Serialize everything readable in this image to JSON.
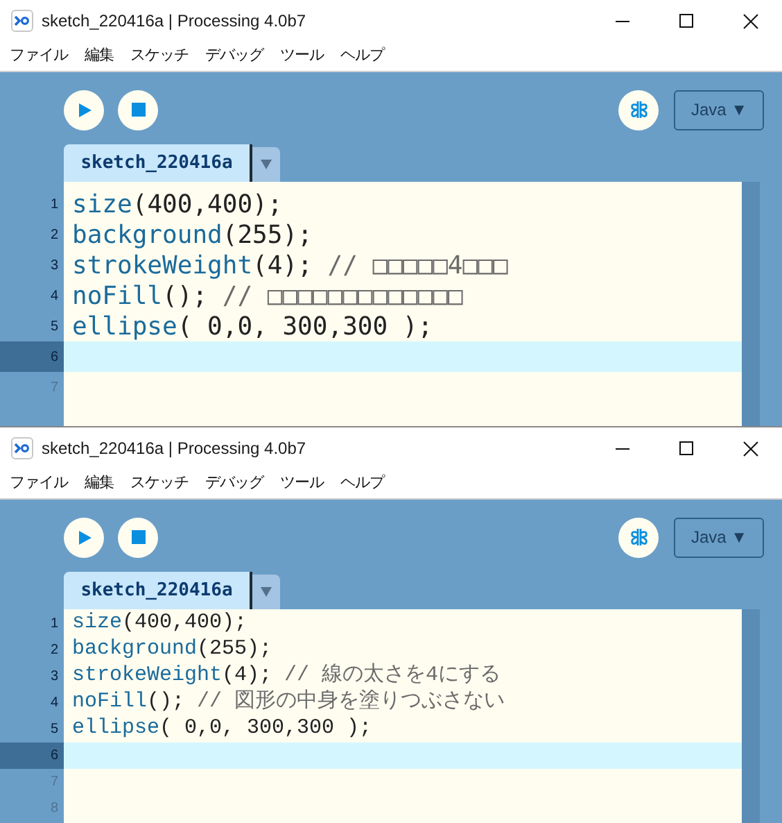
{
  "windows": [
    {
      "title": "sketch_220416a | Processing 4.0b7",
      "menu": [
        "ファイル",
        "編集",
        "スケッチ",
        "デバッグ",
        "ツール",
        "ヘルプ"
      ],
      "tab": {
        "label": "sketch_220416a",
        "selected": true
      },
      "mode": "Java ▼",
      "lines": [
        {
          "number": "1",
          "selected": false,
          "dimmed": false,
          "segments": [
            {
              "kind": "function",
              "text": "size"
            },
            {
              "kind": "plain",
              "text": "(400,400);"
            }
          ]
        },
        {
          "number": "2",
          "selected": false,
          "dimmed": false,
          "segments": [
            {
              "kind": "function",
              "text": "background"
            },
            {
              "kind": "plain",
              "text": "(255);"
            }
          ]
        },
        {
          "number": "3",
          "selected": false,
          "dimmed": false,
          "segments": [
            {
              "kind": "function",
              "text": "strokeWeight"
            },
            {
              "kind": "plain",
              "text": "(4); "
            },
            {
              "kind": "comment",
              "text": "// □□□□□4□□□"
            }
          ]
        },
        {
          "number": "4",
          "selected": false,
          "dimmed": false,
          "segments": [
            {
              "kind": "function",
              "text": "noFill"
            },
            {
              "kind": "plain",
              "text": "(); "
            },
            {
              "kind": "comment",
              "text": "// □□□□□□□□□□□□□"
            }
          ]
        },
        {
          "number": "5",
          "selected": false,
          "dimmed": false,
          "segments": [
            {
              "kind": "function",
              "text": "ellipse"
            },
            {
              "kind": "plain",
              "text": "( 0,0, 300,300 );"
            }
          ]
        },
        {
          "number": "6",
          "selected": true,
          "dimmed": false
        },
        {
          "number": "7",
          "selected": false,
          "dimmed": true
        }
      ]
    },
    {
      "title": "sketch_220416a | Processing 4.0b7",
      "menu": [
        "ファイル",
        "編集",
        "スケッチ",
        "デバッグ",
        "ツール",
        "ヘルプ"
      ],
      "tab": {
        "label": "sketch_220416a",
        "selected": true
      },
      "mode": "Java ▼",
      "lines": [
        {
          "number": "1",
          "selected": false,
          "dimmed": false,
          "segments": [
            {
              "kind": "function",
              "text": "size"
            },
            {
              "kind": "plain",
              "text": "(400,400);"
            }
          ]
        },
        {
          "number": "2",
          "selected": false,
          "dimmed": false,
          "segments": [
            {
              "kind": "function",
              "text": "background"
            },
            {
              "kind": "plain",
              "text": "(255);"
            }
          ]
        },
        {
          "number": "3",
          "selected": false,
          "dimmed": false,
          "segments": [
            {
              "kind": "function",
              "text": "strokeWeight"
            },
            {
              "kind": "plain",
              "text": "(4); "
            },
            {
              "kind": "comment",
              "text": "// 線の太さを4にする"
            }
          ]
        },
        {
          "number": "4",
          "selected": false,
          "dimmed": false,
          "segments": [
            {
              "kind": "function",
              "text": "noFill"
            },
            {
              "kind": "plain",
              "text": "(); "
            },
            {
              "kind": "comment",
              "text": "// 図形の中身を塗りつぶさない"
            }
          ]
        },
        {
          "number": "5",
          "selected": false,
          "dimmed": false,
          "segments": [
            {
              "kind": "function",
              "text": "ellipse"
            },
            {
              "kind": "plain",
              "text": "( 0,0, 300,300 );"
            }
          ]
        },
        {
          "number": "6",
          "selected": true,
          "dimmed": false
        },
        {
          "number": "7",
          "selected": false,
          "dimmed": true
        },
        {
          "number": "8",
          "selected": false,
          "dimmed": true
        }
      ]
    }
  ]
}
